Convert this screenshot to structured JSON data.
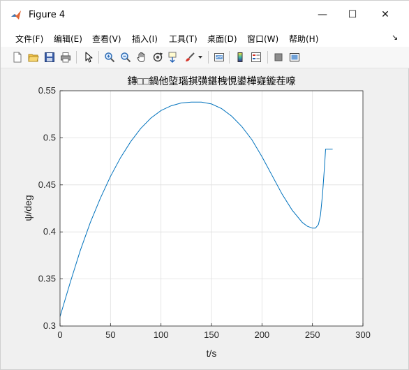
{
  "window": {
    "title": "Figure 4",
    "minimize_glyph": "—",
    "maximize_glyph": "☐",
    "close_glyph": "✕"
  },
  "menu": {
    "items": [
      "文件(F)",
      "编辑(E)",
      "查看(V)",
      "插入(I)",
      "工具(T)",
      "桌面(D)",
      "窗口(W)",
      "帮助(H)"
    ],
    "dock_glyph": "↘"
  },
  "toolbar": {
    "icons": [
      "new-figure-icon",
      "open-folder-icon",
      "save-icon",
      "print-icon",
      "select-arrow-icon",
      "zoom-in-icon",
      "zoom-out-icon",
      "pan-hand-icon",
      "rotate-3d-icon",
      "data-cursor-icon",
      "brush-icon",
      "brush-dropdown-icon",
      "link-plot-icon",
      "colorbar-icon",
      "legend-icon",
      "hide-plot-tools-icon",
      "show-plot-tools-icon"
    ]
  },
  "chart_data": {
    "type": "line",
    "title": "鏄□□鍋他埅瑙掑彉鍖栧悓鍙樺寲鏇茬嚎",
    "xlabel": "t/s",
    "ylabel": "ψ/deg",
    "xlim": [
      0,
      300
    ],
    "ylim": [
      0.3,
      0.55
    ],
    "xticks": [
      0,
      50,
      100,
      150,
      200,
      250,
      300
    ],
    "yticks": [
      0.3,
      0.35,
      0.4,
      0.45,
      0.5,
      0.55
    ],
    "xtick_labels": [
      "0",
      "50",
      "100",
      "150",
      "200",
      "250",
      "300"
    ],
    "ytick_labels": [
      "0.3",
      "0.35",
      "0.4",
      "0.45",
      "0.5",
      "0.55"
    ],
    "grid": true,
    "series": [
      {
        "color": "#0072bd",
        "x": [
          0,
          10,
          20,
          30,
          40,
          50,
          60,
          70,
          80,
          90,
          100,
          110,
          120,
          130,
          140,
          150,
          160,
          170,
          180,
          190,
          200,
          210,
          220,
          230,
          240,
          245,
          250,
          253,
          256,
          258,
          260,
          262,
          263,
          264,
          270
        ],
        "y": [
          0.31,
          0.346,
          0.38,
          0.41,
          0.436,
          0.459,
          0.479,
          0.496,
          0.51,
          0.521,
          0.529,
          0.534,
          0.537,
          0.538,
          0.538,
          0.536,
          0.531,
          0.523,
          0.512,
          0.498,
          0.48,
          0.46,
          0.44,
          0.423,
          0.41,
          0.406,
          0.404,
          0.404,
          0.408,
          0.418,
          0.44,
          0.47,
          0.488,
          0.488,
          0.488
        ]
      }
    ]
  }
}
